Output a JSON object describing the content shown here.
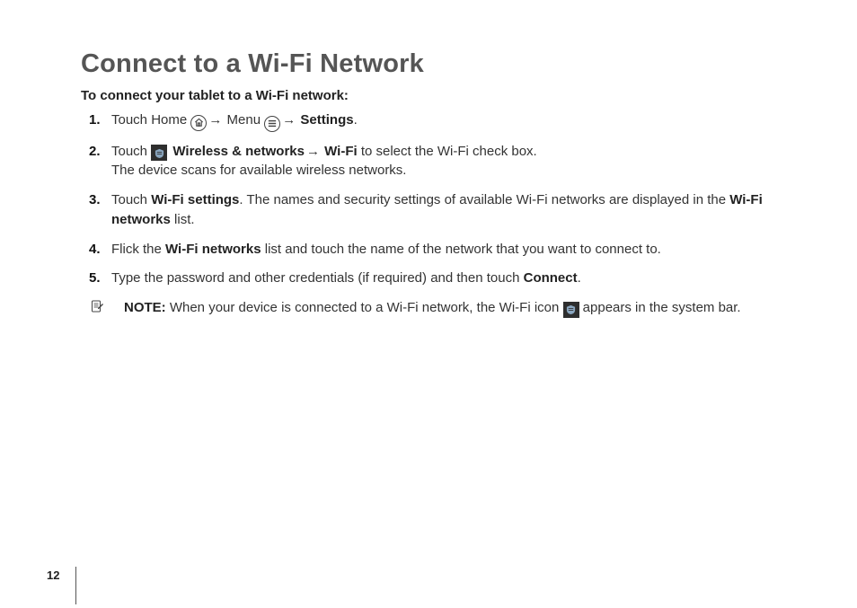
{
  "title": "Connect to a Wi-Fi Network",
  "intro": "To connect your tablet to a Wi-Fi network:",
  "steps": {
    "s1": {
      "num": "1.",
      "touch": "Touch Home ",
      "menu": " Menu ",
      "settings": "Settings"
    },
    "s2": {
      "num": "2.",
      "touch": "Touch ",
      "wireless": "Wireless & networks",
      "wifi": " Wi-Fi",
      "rest": " to select the Wi-Fi check box.",
      "line2": "The device scans for available wireless networks."
    },
    "s3": {
      "num": "3.",
      "touch": "Touch ",
      "wifisettings": "Wi-Fi settings",
      "rest1": ". The names and security settings of available Wi-Fi networks are displayed in the ",
      "wifinetworks": "Wi-Fi networks",
      "rest2": " list."
    },
    "s4": {
      "num": "4.",
      "flick": "Flick the ",
      "wifinetworks": "Wi-Fi networks",
      "rest": " list and touch the name of the network that you want to connect to."
    },
    "s5": {
      "num": "5.",
      "text": "Type the password and other credentials (if required) and then touch ",
      "connect": "Connect",
      "period": "."
    }
  },
  "note": {
    "label": "NOTE:",
    "text1": " When your device is connected to a Wi-Fi network, the Wi-Fi icon ",
    "text2": " appears in the system bar."
  },
  "arrow": "→",
  "pageNumber": "12"
}
